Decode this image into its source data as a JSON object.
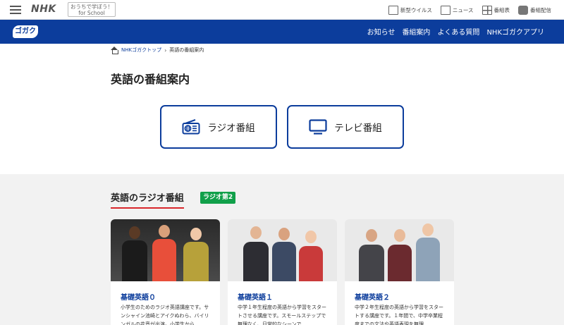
{
  "topbar": {
    "nhk_logo": "NHK",
    "school_badge_line1": "おうちで学ぼう！",
    "school_badge_line2": "for School",
    "links": [
      {
        "label": "新型ウイルス",
        "icon": "virus-news-icon"
      },
      {
        "label": "ニュース",
        "icon": "news-icon"
      },
      {
        "label": "番組表",
        "icon": "program-guide-icon"
      },
      {
        "label": "番組配信",
        "icon": "streaming-icon"
      }
    ]
  },
  "header": {
    "logo": "ゴガク",
    "nav": [
      "お知らせ",
      "番組案内",
      "よくある質問",
      "NHKゴガクアプリ"
    ]
  },
  "breadcrumb": {
    "home_label": "NHKゴガクトップ",
    "separator": "›",
    "current": "英語の番組案内"
  },
  "page_title": "英語の番組案内",
  "type_buttons": {
    "radio_label": "ラジオ番組",
    "tv_label": "テレビ番組"
  },
  "radio_section": {
    "title": "英語のラジオ番組",
    "channel": "ラジオ第2",
    "cards": [
      {
        "title": "基礎英語０",
        "description": "小学生のためのラジオ英語講座です。サンシャイン池崎とアイクぬわら、バイリンガルの花音が出演。小学生から"
      },
      {
        "title": "基礎英語１",
        "description": "中学１年生程度の英語から学習をスタートさせる講座です。スモールステップで無理なく、日常的なシーンで"
      },
      {
        "title": "基礎英語２",
        "description": "中学２年生程度の英語から学習をスタートする講座です。１年間で、中学卒業程度までの文法や英語表現を無理"
      }
    ]
  },
  "colors": {
    "brand_blue": "#0c3d9c",
    "accent_red": "#d9262b",
    "channel_green": "#11a04a",
    "section_bg": "#f2f2f2"
  }
}
